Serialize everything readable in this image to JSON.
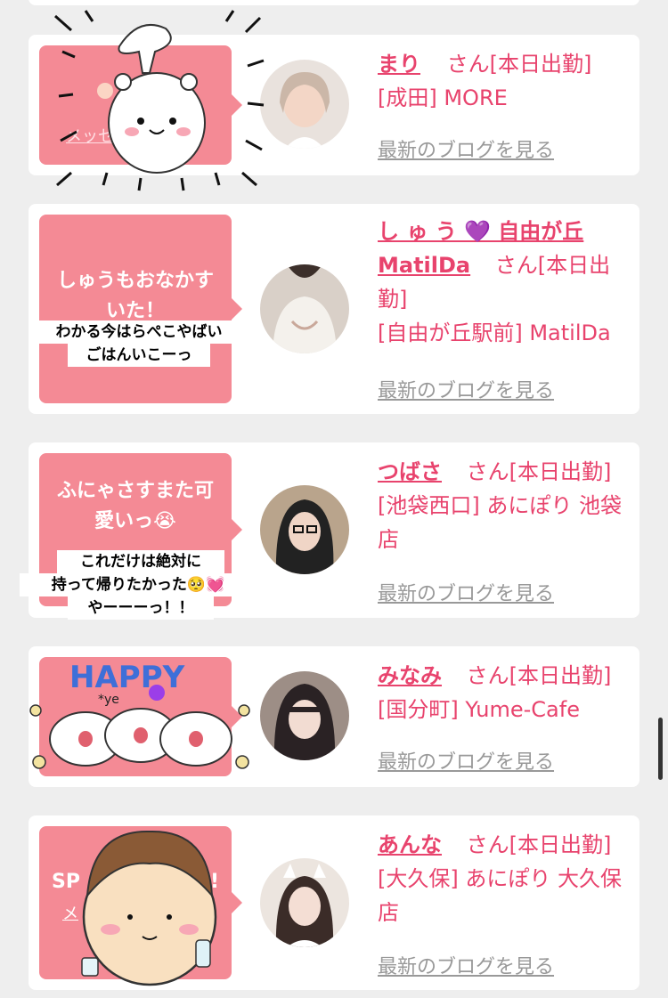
{
  "colors": {
    "accent": "#e8436d",
    "bubble": "#f48a95",
    "background": "#eeeeee",
    "link_gray": "#999999"
  },
  "cards": [
    {
      "bubble_text": "メッセ",
      "name": "まり",
      "san": "さん",
      "status": "[本日出勤]",
      "location": "[成田] MORE",
      "blog_link": "最新のブログを見る",
      "sticker": "hamster-icon"
    },
    {
      "bubble_text": "しゅうもおなかすいた！",
      "caption_line1": "わかる今はらぺこやばい",
      "caption_line2": "ごはんいこーっ",
      "name_line1": "し ゅ う 💜 自由が丘",
      "name_line2": "MatilDa",
      "san": "さん",
      "status": "[本日出勤]",
      "location": "[自由が丘駅前] MatilDa",
      "blog_link": "最新のブログを見る"
    },
    {
      "bubble_text": "ふにゃさすまた可愛いっ😭",
      "caption_line1": "これだけは絶対に",
      "caption_line2": "持って帰りたかった🥺💓",
      "caption_line3": "やーーーっ！！",
      "name": "つばさ",
      "san": "さん",
      "status": "[本日出勤]",
      "location": "[池袋西口] あにぽり 池袋店",
      "blog_link": "最新のブログを見る"
    },
    {
      "sticker_text": "HAPPY",
      "sticker_sub": "*ye",
      "name": "みなみ",
      "san": "さん",
      "status": "[本日出勤]",
      "location": "[国分町] Yume-Cafe",
      "blog_link": "最新のブログを見る"
    },
    {
      "bubble_text_left": "SP",
      "bubble_text_right": "!",
      "bubble_sub": "メ",
      "name": "あんな",
      "san": "さん",
      "status": "[本日出勤]",
      "location": "[大久保] あにぽり 大久保店",
      "blog_link": "最新のブログを見る"
    }
  ]
}
